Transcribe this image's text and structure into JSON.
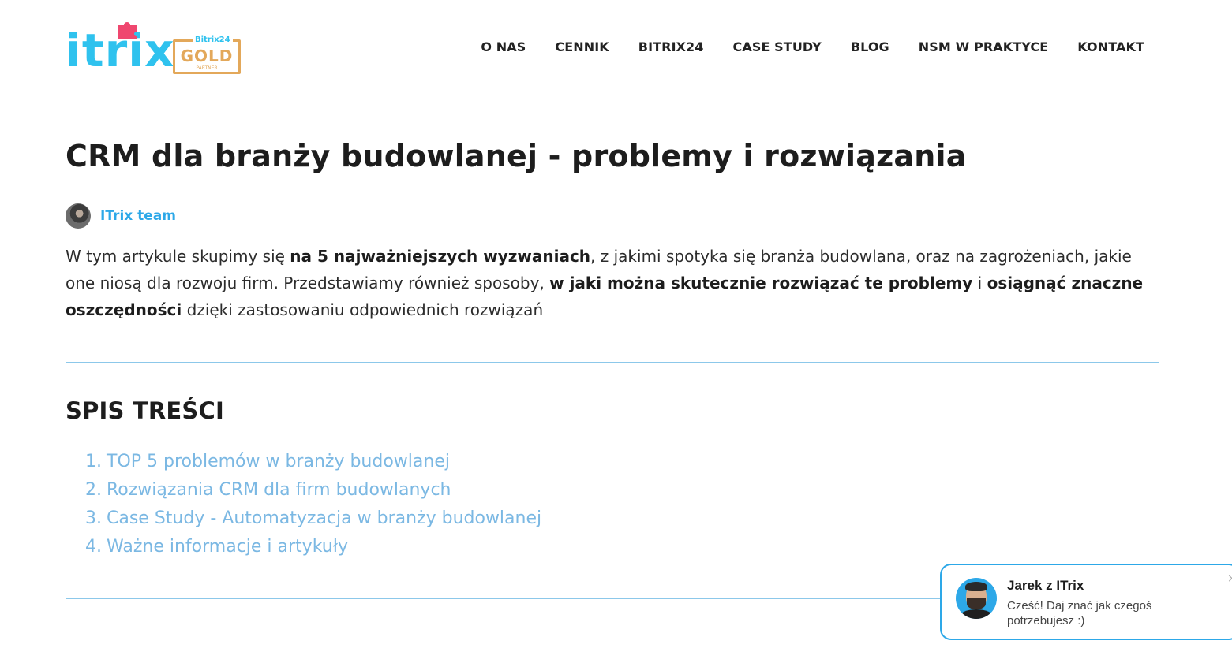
{
  "brand": {
    "logo_text": "itrix",
    "badge_top": "Bitrix24",
    "badge_word": "GOLD",
    "badge_bottom": "PARTNER",
    "primary_color": "#2fc2ee",
    "gold_color": "#e3a85a"
  },
  "nav": {
    "items": [
      "O NAS",
      "CENNIK",
      "BITRIX24",
      "CASE STUDY",
      "BLOG",
      "NSM W PRAKTYCE",
      "KONTAKT"
    ]
  },
  "article": {
    "title": "CRM dla branży budowlanej - problemy i rozwiązania",
    "author": "ITrix team",
    "intro": [
      {
        "t": "W tym artykule skupimy się ",
        "b": false
      },
      {
        "t": "na 5 najważniejszych wyzwaniach",
        "b": true
      },
      {
        "t": ", z jakimi spotyka się branża budowlana, oraz na zagrożeniach, jakie one niosą dla rozwoju firm. Przedstawiamy również sposoby, ",
        "b": false
      },
      {
        "t": "w jaki można skutecznie rozwiązać te problemy",
        "b": true
      },
      {
        "t": " i ",
        "b": false
      },
      {
        "t": "osiągnąć znaczne oszczędności",
        "b": true
      },
      {
        "t": " dzięki zastosowaniu odpowiednich rozwiązań",
        "b": false
      }
    ]
  },
  "toc": {
    "title": "SPIS TREŚCI",
    "items": [
      {
        "num": "1.",
        "label": "TOP 5 problemów w branży budowlanej"
      },
      {
        "num": "2.",
        "label": "Rozwiązania CRM dla firm budowlanych"
      },
      {
        "num": "3.",
        "label": "Case Study - Automatyzacja w branży budowlanej"
      },
      {
        "num": "4.",
        "label": "Ważne informacje i artykuły"
      }
    ]
  },
  "chat": {
    "name": "Jarek z ITrix",
    "message": "Cześć! Daj znać jak czegoś potrzebujesz :)",
    "close": "×"
  }
}
